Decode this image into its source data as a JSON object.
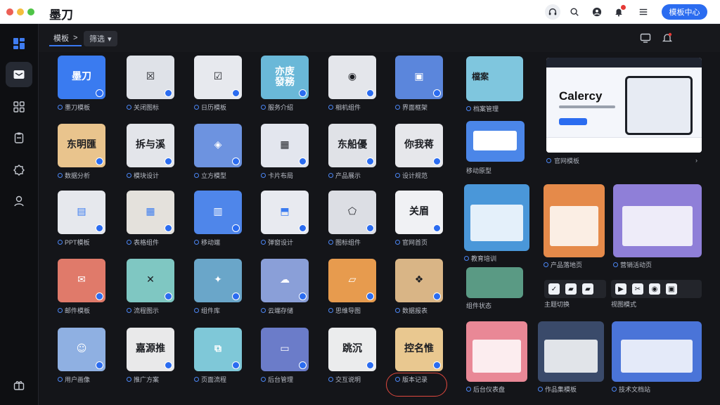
{
  "app": {
    "title": "墨刀",
    "primary_button": "模板中心"
  },
  "topbar": {
    "icons": [
      "headset-icon",
      "search-icon",
      "user-circle-icon",
      "bell-icon",
      "menu-icon"
    ]
  },
  "sidebar": {
    "items": [
      "dashboard-icon",
      "message-icon",
      "grid-icon",
      "clipboard-icon",
      "puzzle-icon",
      "user-icon",
      "gift-icon"
    ]
  },
  "subbar": {
    "breadcrumb": "模板",
    "breadcrumb_sep": ">",
    "dropdown": "筛选",
    "dropdown_caret": "▾"
  },
  "colors": {
    "accent": "#2b6cf0",
    "sidebar_bg": "#0e0f12",
    "page_bg": "#141519"
  },
  "grid": {
    "tiles": [
      {
        "text": "墨刀",
        "color": "#3a7bf0",
        "fg": "#ffffff",
        "label": "墨刀模板"
      },
      {
        "text": "☒",
        "color": "#dfe2e8",
        "fg": "#1b1d22",
        "label": "关闭图标"
      },
      {
        "text": "☑",
        "color": "#e7e9ee",
        "fg": "#1b1d22",
        "label": "日历模板"
      },
      {
        "text": "亦庋\n發務",
        "color": "#6ab8d8",
        "fg": "#ffffff",
        "label": "服务介绍"
      },
      {
        "text": "◉",
        "color": "#e4e6eb",
        "fg": "#1b1d22",
        "label": "相机组件"
      },
      {
        "text": "▣",
        "color": "#5b86dc",
        "fg": "#ffffff",
        "label": "界面框架"
      },
      {
        "text": "檔案",
        "color": "#8fd0e0",
        "fg": "#1b1d22",
        "label": "档案管理"
      },
      {
        "text": "东明匯",
        "color": "#e9c48d",
        "fg": "#1b1d22",
        "label": "数据分析"
      },
      {
        "text": "拆与溪",
        "color": "#e3e5ea",
        "fg": "#1b1d22",
        "label": "模块设计"
      },
      {
        "text": "◈",
        "color": "#6d93e0",
        "fg": "#ffffff",
        "label": "立方模型"
      },
      {
        "text": "▦",
        "color": "#e3e6ee",
        "fg": "#1b1d22",
        "label": "卡片布局"
      },
      {
        "text": "东船優",
        "color": "#e0e2e7",
        "fg": "#1b1d22",
        "label": "产品展示"
      },
      {
        "text": "你我蒋",
        "color": "#e6e7eb",
        "fg": "#1b1d22",
        "label": "设计规范"
      },
      {
        "text": "▤",
        "color": "#e6e8ed",
        "fg": "#3a7bf0",
        "label": "PPT模板"
      },
      {
        "text": "▦",
        "color": "#e4e1dc",
        "fg": "#3a7bf0",
        "label": "表格组件"
      },
      {
        "text": "▥",
        "color": "#4f86ea",
        "fg": "#ffffff",
        "label": "移动端"
      },
      {
        "text": "⬒",
        "color": "#e8eaf0",
        "fg": "#3a7bf0",
        "label": "弹窗设计"
      },
      {
        "text": "⬠",
        "color": "#dcdee4",
        "fg": "#1b1d22",
        "label": "图标组件"
      },
      {
        "text": "关眉",
        "color": "#f0f1f4",
        "fg": "#1b1d22",
        "label": "官网首页"
      },
      {
        "text": "✉",
        "color": "#e07a6a",
        "fg": "#ffffff",
        "label": "邮件模板"
      },
      {
        "text": "✕",
        "color": "#7fc7c2",
        "fg": "#1b1d22",
        "label": "流程图示"
      },
      {
        "text": "✦",
        "color": "#6aa6c9",
        "fg": "#ffffff",
        "label": "组件库"
      },
      {
        "text": "☁",
        "color": "#8a9fd8",
        "fg": "#ffffff",
        "label": "云端存储"
      },
      {
        "text": "▱",
        "color": "#e79b4e",
        "fg": "#ffffff",
        "label": "思维导图"
      },
      {
        "text": "❖",
        "color": "#d9b586",
        "fg": "#1b1d22",
        "label": "数据报表"
      },
      {
        "text": "☺",
        "color": "#8fb0e2",
        "fg": "#ffffff",
        "label": "用户画像"
      },
      {
        "text": "嘉源推",
        "color": "#e9e9ea",
        "fg": "#1b1d22",
        "label": "推广方案"
      },
      {
        "text": "⧉",
        "color": "#7fc8d8",
        "fg": "#ffffff",
        "label": "页面流程"
      },
      {
        "text": "▭",
        "color": "#6b7cc9",
        "fg": "#ffffff",
        "label": "后台管理"
      },
      {
        "text": "跳沉",
        "color": "#ebeced",
        "fg": "#1b1d22",
        "label": "交互说明"
      },
      {
        "text": "控名惟",
        "color": "#e9c890",
        "fg": "#1b1d22",
        "label": "版本记录"
      }
    ]
  },
  "previews": {
    "hero": {
      "title": "Calercy",
      "caption": "官网模板",
      "arrow": "›"
    },
    "side_caption": "移动原型",
    "cards": [
      {
        "label": "教育培训",
        "color": "#4a97d9"
      },
      {
        "label": "产品落地页",
        "color": "#e58a4a"
      },
      {
        "label": "营销活动页",
        "color": "#8f7fd8"
      },
      {
        "label": "后台仪表盘",
        "color": "#e98896"
      },
      {
        "label": "作品集模板",
        "color": "#3a4a6a"
      },
      {
        "label": "技术文档站",
        "color": "#4a74d8"
      }
    ],
    "toolbar_a": [
      "✓",
      "▰",
      "▰"
    ],
    "toolbar_b": [
      "▶",
      "✂",
      "◉",
      "▣"
    ],
    "toolbar_caption_a": "主题切换",
    "toolbar_caption_b": "视图模式",
    "small_caption": "组件状态"
  }
}
